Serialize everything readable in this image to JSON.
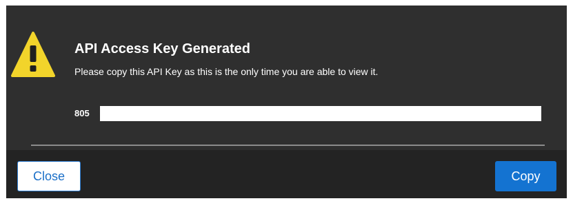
{
  "dialog": {
    "title": "API Access Key Generated",
    "message": "Please copy this API Key as this is the only time you are able to view it.",
    "key_prefix": "805",
    "warning_icon": "warning-triangle-icon",
    "warning_color": "#f2d42b",
    "background_color": "#2f2f2f",
    "footer_color": "#232323"
  },
  "footer": {
    "close_label": "Close",
    "copy_label": "Copy",
    "accent_color": "#1473d1"
  }
}
